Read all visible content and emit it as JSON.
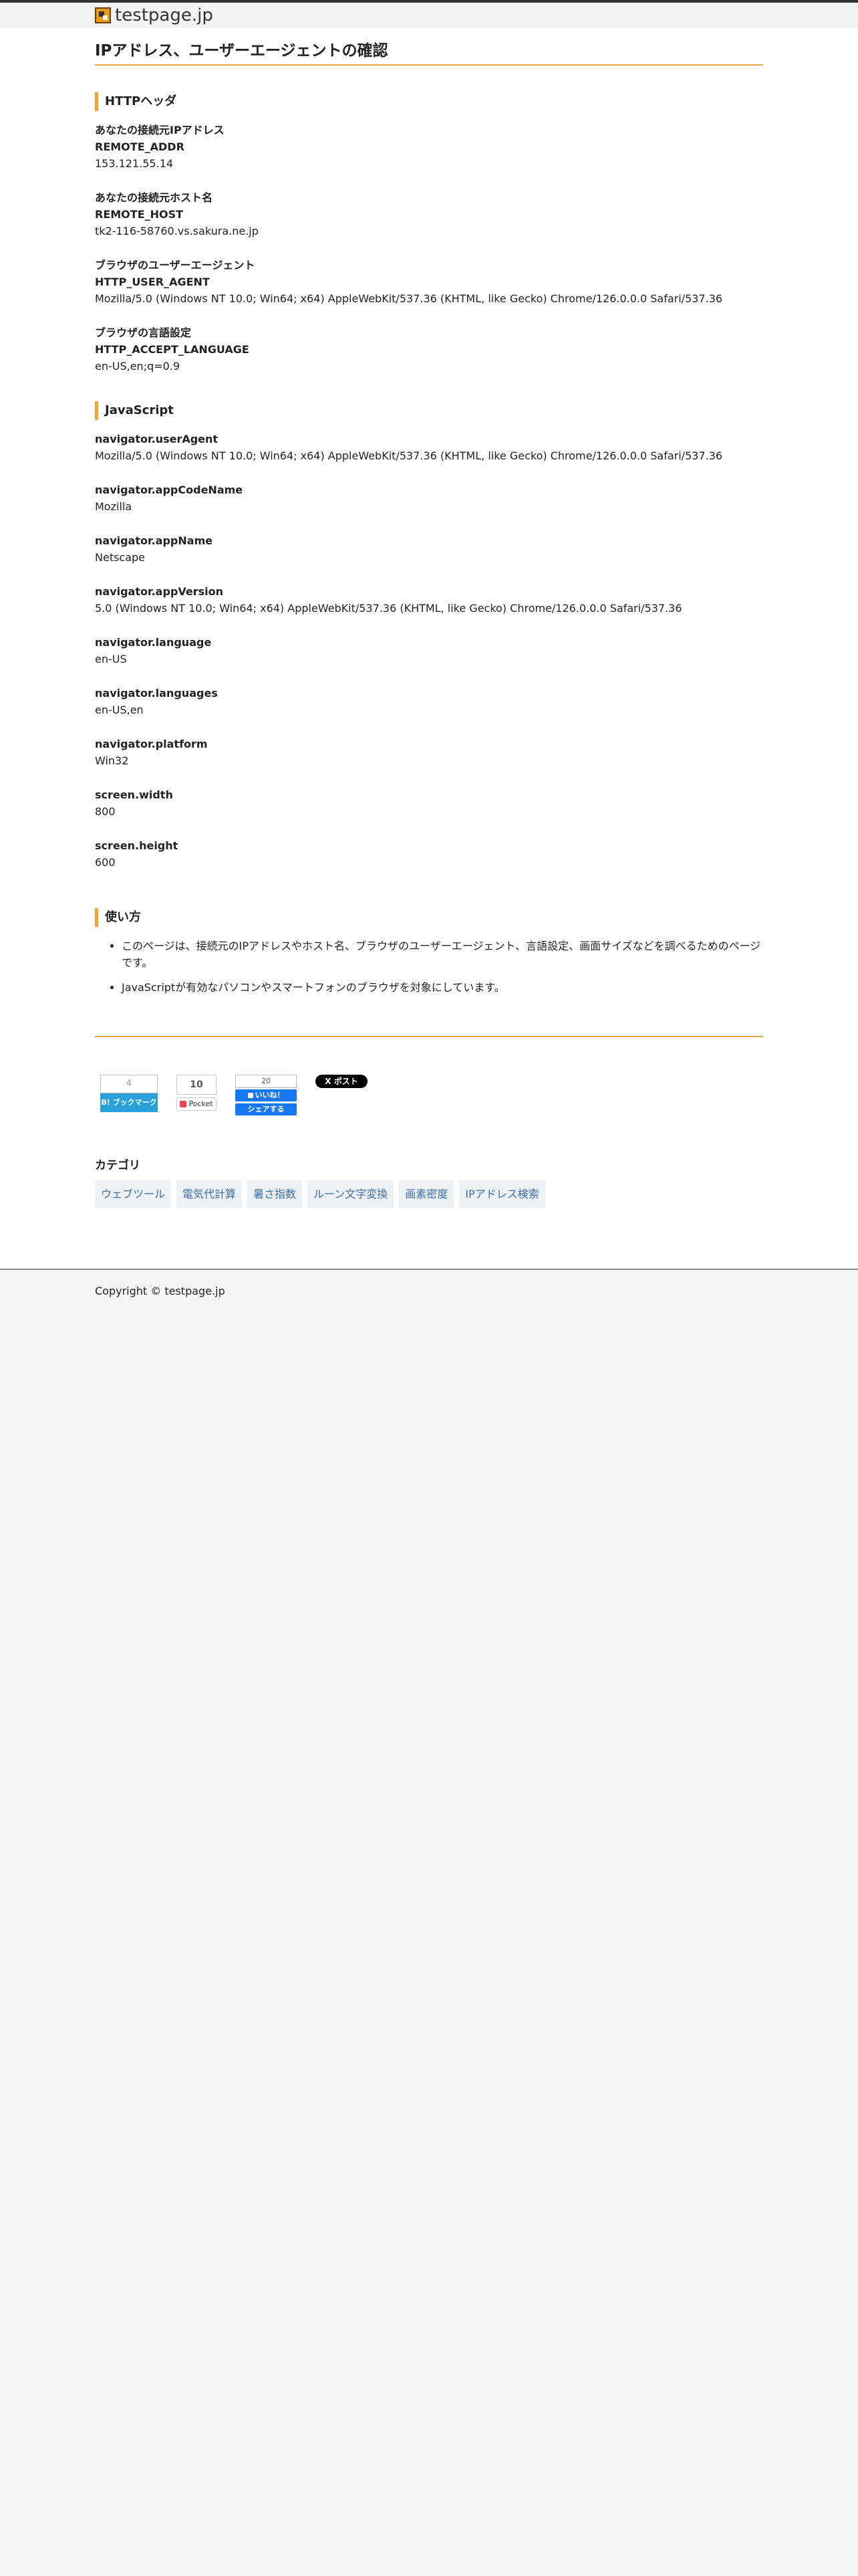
{
  "site": {
    "name": "testpage.jp"
  },
  "page": {
    "title": "IPアドレス、ユーザーエージェントの確認"
  },
  "http": {
    "heading": "HTTPヘッダ",
    "items": [
      {
        "label": "あなたの接続元IPアドレス",
        "key": "REMOTE_ADDR",
        "value": "153.121.55.14"
      },
      {
        "label": "あなたの接続元ホスト名",
        "key": "REMOTE_HOST",
        "value": "tk2-116-58760.vs.sakura.ne.jp"
      },
      {
        "label": "ブラウザのユーザーエージェント",
        "key": "HTTP_USER_AGENT",
        "value": "Mozilla/5.0 (Windows NT 10.0; Win64; x64) AppleWebKit/537.36 (KHTML, like Gecko) Chrome/126.0.0.0 Safari/537.36"
      },
      {
        "label": "ブラウザの言語設定",
        "key": "HTTP_ACCEPT_LANGUAGE",
        "value": "en-US,en;q=0.9"
      }
    ]
  },
  "js": {
    "heading": "JavaScript",
    "items": [
      {
        "key": "navigator.userAgent",
        "value": "Mozilla/5.0 (Windows NT 10.0; Win64; x64) AppleWebKit/537.36 (KHTML, like Gecko) Chrome/126.0.0.0 Safari/537.36"
      },
      {
        "key": "navigator.appCodeName",
        "value": "Mozilla"
      },
      {
        "key": "navigator.appName",
        "value": "Netscape"
      },
      {
        "key": "navigator.appVersion",
        "value": "5.0 (Windows NT 10.0; Win64; x64) AppleWebKit/537.36 (KHTML, like Gecko) Chrome/126.0.0.0 Safari/537.36"
      },
      {
        "key": "navigator.language",
        "value": "en-US"
      },
      {
        "key": "navigator.languages",
        "value": "en-US,en"
      },
      {
        "key": "navigator.platform",
        "value": "Win32"
      },
      {
        "key": "screen.width",
        "value": "800"
      },
      {
        "key": "screen.height",
        "value": "600"
      }
    ]
  },
  "usage": {
    "heading": "使い方",
    "items": [
      "このページは、接続元のIPアドレスやホスト名、ブラウザのユーザーエージェント、言語設定、画面サイズなどを調べるためのページです。",
      "JavaScriptが有効なパソコンやスマートフォンのブラウザを対象にしています。"
    ]
  },
  "share": {
    "hatena": {
      "count": "4",
      "label": "B! ブックマーク"
    },
    "pocket": {
      "count": "10",
      "label": "Pocket"
    },
    "facebook": {
      "count": "20",
      "like": "いいね！",
      "share": "シェアする"
    },
    "x": {
      "label": "X ポスト"
    }
  },
  "categories": {
    "heading": "カテゴリ",
    "items": [
      "ウェブツール",
      "電気代計算",
      "暑さ指数",
      "ルーン文字変換",
      "画素密度",
      "IPアドレス検索"
    ]
  },
  "footer": {
    "copyright": "Copyright © testpage.jp"
  }
}
